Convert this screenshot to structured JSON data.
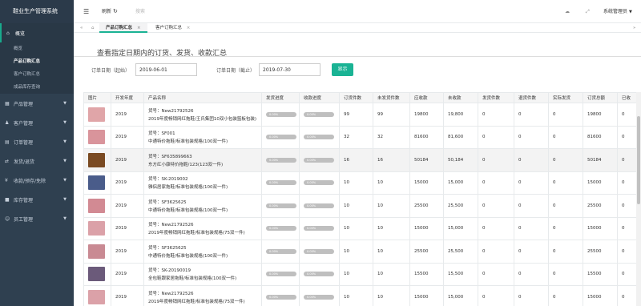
{
  "app": {
    "title": "鞋业生产管理系统"
  },
  "sidebar": {
    "items": [
      {
        "label": "概览",
        "icon": "home-icon"
      },
      {
        "label": "产品管理",
        "icon": "box-icon"
      },
      {
        "label": "客户管理",
        "icon": "users-icon"
      },
      {
        "label": "订单管理",
        "icon": "order-icon"
      },
      {
        "label": "发货/退货",
        "icon": "truck-icon"
      },
      {
        "label": "收款/预存/免除",
        "icon": "money-icon"
      },
      {
        "label": "库存管理",
        "icon": "stock-icon"
      },
      {
        "label": "员工管理",
        "icon": "staff-icon"
      }
    ],
    "sub": [
      "概览",
      "产品订购汇总",
      "客户订购汇总",
      "成品库存查询"
    ]
  },
  "topbar": {
    "refresh_label": "刷新",
    "search_placeholder": "搜索",
    "user": "系统管理员"
  },
  "tabs": [
    {
      "label": "产品订购汇总"
    },
    {
      "label": "客户订购汇总"
    }
  ],
  "page": {
    "title": "查看指定日期内的订货、发货、收款汇总"
  },
  "filter": {
    "start_label": "订单日期（起始）",
    "start_value": "2019-06-01",
    "end_label": "订单日期（截止）",
    "end_value": "2019-07-30",
    "button": "显示"
  },
  "table": {
    "headers": [
      "图片",
      "开发年度",
      "产品名称",
      "发货进度",
      "收款进度",
      "订货件数",
      "未发货件数",
      "应收款",
      "未收款",
      "发货件数",
      "退货件数",
      "实际发货",
      "订货总额",
      "已收"
    ],
    "rows": [
      {
        "year": "2019",
        "code": "货号：New21792526",
        "desc": "2019年度畅销网红拖鞋/王氏集团10双小包装篮板包装)",
        "ship": "0.00%",
        "pay": "0.00%",
        "qty": "99",
        "unship": "99",
        "due": "19800",
        "unpaid": "19,800",
        "shipped": "0",
        "ret": "0",
        "actual": "0",
        "total": "19800",
        "paid": "0",
        "color": "#e0a5a8"
      },
      {
        "year": "2019",
        "code": "货号：SF001",
        "desc": "中通特价拖鞋/标准包装规格(100双一件)",
        "ship": "0.00%",
        "pay": "0.00%",
        "qty": "32",
        "unship": "32",
        "due": "81600",
        "unpaid": "81,600",
        "shipped": "0",
        "ret": "0",
        "actual": "0",
        "total": "81600",
        "paid": "0",
        "color": "#d9949b"
      },
      {
        "year": "2019",
        "code": "货号：SF635899663",
        "desc": "东方红小康特价拖鞋/123(123双一件)",
        "ship": "0.00%",
        "pay": "0.00%",
        "qty": "16",
        "unship": "16",
        "due": "50184",
        "unpaid": "50,184",
        "shipped": "0",
        "ret": "0",
        "actual": "0",
        "total": "50184",
        "paid": "0",
        "color": "#7a4a22"
      },
      {
        "year": "2019",
        "code": "货号：SK-2019002",
        "desc": "雅侣居家拖鞋/标准包装规格(100双一件)",
        "ship": "0.00%",
        "pay": "0.00%",
        "qty": "10",
        "unship": "10",
        "due": "15000",
        "unpaid": "15,000",
        "shipped": "0",
        "ret": "0",
        "actual": "0",
        "total": "15000",
        "paid": "0",
        "color": "#4a5c8a"
      },
      {
        "year": "2019",
        "code": "货号：SF3625625",
        "desc": "中通特价拖鞋/标准包装规格(100双一件)",
        "ship": "0.00%",
        "pay": "0.00%",
        "qty": "10",
        "unship": "10",
        "due": "25500",
        "unpaid": "25,500",
        "shipped": "0",
        "ret": "0",
        "actual": "0",
        "total": "25500",
        "paid": "0",
        "color": "#d28a93"
      },
      {
        "year": "2019",
        "code": "货号：New21792526",
        "desc": "2019年度畅销网红拖鞋/标准包装规格(75双一件)",
        "ship": "0.00%",
        "pay": "0.00%",
        "qty": "10",
        "unship": "10",
        "due": "15000",
        "unpaid": "15,000",
        "shipped": "0",
        "ret": "0",
        "actual": "0",
        "total": "15000",
        "paid": "0",
        "color": "#dba1a8"
      },
      {
        "year": "2019",
        "code": "货号：SF3625625",
        "desc": "中通特价拖鞋/标准包装规格(100双一件)",
        "ship": "0.00%",
        "pay": "0.00%",
        "qty": "10",
        "unship": "10",
        "due": "25500",
        "unpaid": "25,500",
        "shipped": "0",
        "ret": "0",
        "actual": "0",
        "total": "25500",
        "paid": "0",
        "color": "#c98a93"
      },
      {
        "year": "2019",
        "code": "货号：SK-20190019",
        "desc": "全包鞋跟家居拖鞋/标准包装规格(100双一件)",
        "ship": "0.00%",
        "pay": "0.00%",
        "qty": "10",
        "unship": "10",
        "due": "15500",
        "unpaid": "15,500",
        "shipped": "0",
        "ret": "0",
        "actual": "0",
        "total": "15500",
        "paid": "0",
        "color": "#6b5a7a"
      },
      {
        "year": "2019",
        "code": "货号：New21792526",
        "desc": "2019年度畅销网红拖鞋/标准包装规格(75双一件)",
        "ship": "0.00%",
        "pay": "0.00%",
        "qty": "10",
        "unship": "10",
        "due": "15000",
        "unpaid": "15,000",
        "shipped": "0",
        "ret": "0",
        "actual": "0",
        "total": "15000",
        "paid": "0",
        "color": "#dba1a8"
      }
    ]
  }
}
